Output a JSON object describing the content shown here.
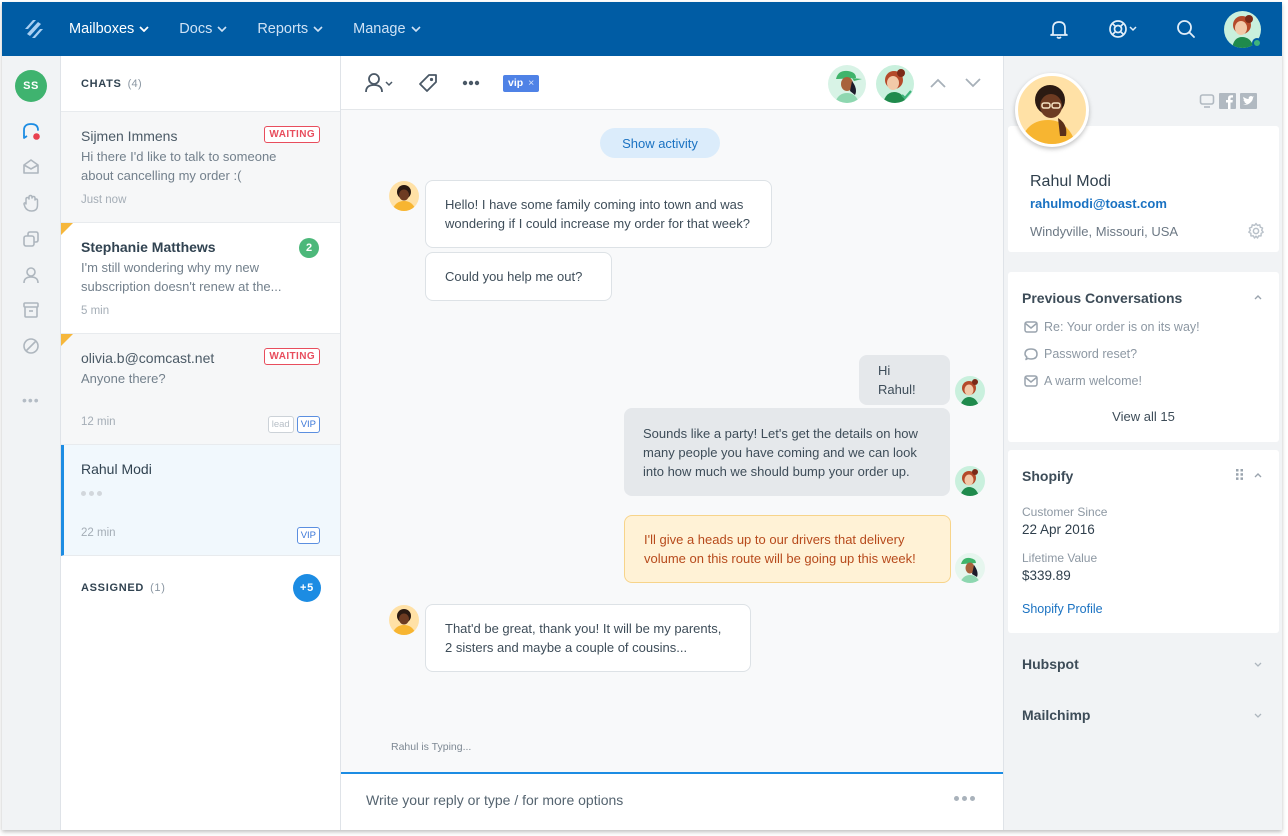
{
  "topnav": {
    "items": [
      {
        "label": "Mailboxes",
        "active": true
      },
      {
        "label": "Docs",
        "active": false
      },
      {
        "label": "Reports",
        "active": false
      },
      {
        "label": "Manage",
        "active": false
      }
    ],
    "icons": [
      "bell-icon",
      "help-lifebuoy-icon",
      "search-icon",
      "user-avatar"
    ],
    "user_status": "online"
  },
  "rail": {
    "user_initials": "SS",
    "icons": [
      "chat-icon",
      "inbox-icon",
      "hand-icon",
      "copy-icon",
      "person-icon",
      "archive-icon",
      "blocked-icon",
      "more-icon"
    ],
    "more_label": "•••"
  },
  "chatlist": {
    "header": {
      "label": "CHATS",
      "count": "(4)"
    },
    "items": [
      {
        "name": "Sijmen Immens",
        "message": "Hi there I'd like to talk to someone about cancelling my order :(",
        "time": "Just now",
        "badge": "WAITING"
      },
      {
        "name": "Stephanie Matthews",
        "message": "I'm still wondering why my new subscription doesn't renew at the...",
        "time": "5 min",
        "unread": "2"
      },
      {
        "name": "olivia.b@comcast.net",
        "message": "Anyone there?",
        "time": "12 min",
        "badge": "WAITING",
        "tags": [
          "lead",
          "VIP"
        ]
      },
      {
        "name": "Rahul Modi",
        "message": "",
        "time": "22 min",
        "tags": [
          "VIP"
        ],
        "typing": true
      }
    ],
    "assigned": {
      "label": "ASSIGNED",
      "count": "(1)",
      "more": "+5"
    }
  },
  "conversation": {
    "toolbar": {
      "tag": "vip",
      "tag_remove": "×"
    },
    "show_activity": "Show activity",
    "messages": [
      {
        "from": "customer",
        "text": "Hello! I have some family coming into town and was wondering if I could increase my order for that week?"
      },
      {
        "from": "customer",
        "text": "Could you help me out?"
      },
      {
        "from": "agent",
        "text": "Hi Rahul!"
      },
      {
        "from": "agent",
        "text": "Sounds like a party! Let's get the details on how many people you have coming and we can look into how much we should bump your order up."
      },
      {
        "from": "agent-note",
        "text": "I'll give a heads up to our drivers that delivery volume on this route will be going up this week!"
      },
      {
        "from": "customer",
        "text": "That'd be great, thank you!  It will be my parents, 2 sisters and maybe a couple of cousins..."
      }
    ],
    "typing_status": "Rahul is Typing...",
    "reply_placeholder": "Write your reply or type / for more options"
  },
  "sidebar": {
    "profile": {
      "name": "Rahul Modi",
      "email": "rahulmodi@toast.com",
      "location": "Windyville, Missouri, USA"
    },
    "previous_conversations": {
      "title": "Previous Conversations",
      "items": [
        {
          "icon": "mail-icon",
          "label": "Re: Your order is on its way!"
        },
        {
          "icon": "chat-bubble-icon",
          "label": "Password reset?"
        },
        {
          "icon": "mail-icon",
          "label": "A warm welcome!"
        }
      ],
      "view_all": "View all 15"
    },
    "shopify": {
      "title": "Shopify",
      "customer_since_label": "Customer Since",
      "customer_since": "22 Apr 2016",
      "lifetime_value_label": "Lifetime Value",
      "lifetime_value": "$339.89",
      "profile_link": "Shopify Profile"
    },
    "hubspot": {
      "title": "Hubspot"
    },
    "mailchimp": {
      "title": "Mailchimp"
    }
  }
}
